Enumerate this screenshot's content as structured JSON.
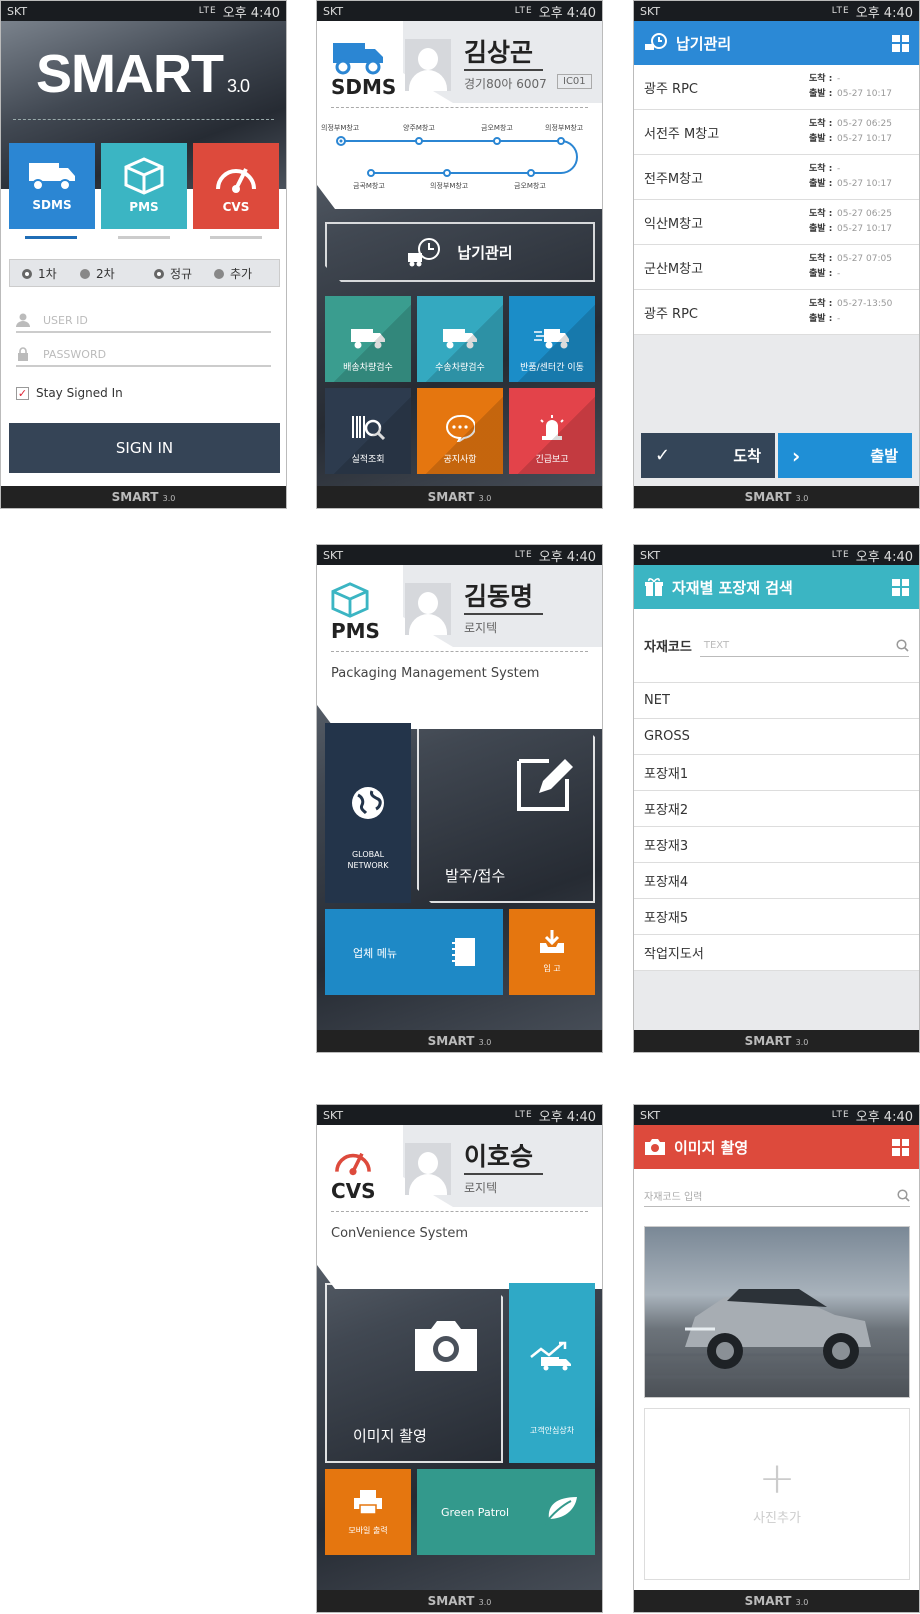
{
  "status": {
    "carrier": "SKT",
    "net": "LTE",
    "time": "오후 4:40"
  },
  "footer": {
    "brand": "SMART",
    "ver": "3.0"
  },
  "login": {
    "logo": "SMART",
    "logo_ver": "3.0",
    "apps": [
      {
        "label": "SDMS",
        "color": "#2b86d3"
      },
      {
        "label": "PMS",
        "color": "#3bb5c3"
      },
      {
        "label": "CVS",
        "color": "#dd4a3c"
      }
    ],
    "radios": [
      "1차",
      "2차",
      "정규",
      "추가"
    ],
    "user_placeholder": "USER ID",
    "pass_placeholder": "PASSWORD",
    "stay": "Stay Signed In",
    "signin": "SIGN IN"
  },
  "sdms": {
    "brand": "SDMS",
    "name": "김상곤",
    "plate": "경기80아 6007",
    "code": "IC01",
    "route_top": [
      "의정부M창고",
      "양주M창고",
      "금오M창고",
      "의정부M창고"
    ],
    "route_bot": [
      "금곡M창고",
      "의정부M창고",
      "금오M창고"
    ],
    "main": "납기관리",
    "tiles": [
      {
        "label": "배송차량검수",
        "color": "#3a9d8f"
      },
      {
        "label": "수송차량검수",
        "color": "#34a9c0"
      },
      {
        "label": "반품/센터간 이동",
        "color": "#1b8dc8"
      },
      {
        "label": "실적조회",
        "color": "#2d3b4e"
      },
      {
        "label": "공지사항",
        "color": "#e5760f"
      },
      {
        "label": "긴급보고",
        "color": "#e3434a"
      }
    ]
  },
  "delivery": {
    "title": "납기관리",
    "arr": "도착 :",
    "dep": "출발 :",
    "rows": [
      {
        "name": "광주 RPC",
        "a": "-",
        "d": "05-27 10:17"
      },
      {
        "name": "서전주 M창고",
        "a": "05-27 06:25",
        "d": "05-27 10:17"
      },
      {
        "name": "전주M창고",
        "a": "-",
        "d": "05-27 10:17"
      },
      {
        "name": "익산M창고",
        "a": "05-27 06:25",
        "d": "05-27 10:17"
      },
      {
        "name": "군산M창고",
        "a": "05-27 07:05",
        "d": "-"
      },
      {
        "name": "광주 RPC",
        "a": "05-27-13:50",
        "d": "-"
      }
    ],
    "btn_arrive": "도착",
    "btn_depart": "출발"
  },
  "pms": {
    "brand": "PMS",
    "name": "김동명",
    "company": "로지텍",
    "full": "Packaging Management System",
    "global": "GLOBAL NETWORK",
    "order": "발주/접수",
    "vendor": "업체 메뉴",
    "inbound": "입 고"
  },
  "search": {
    "title": "자재별 포장재 검색",
    "label": "자재코드",
    "placeholder": "TEXT",
    "items": [
      "NET",
      "GROSS",
      "포장재1",
      "포장재2",
      "포장재3",
      "포장재4",
      "포장재5",
      "작업지도서"
    ]
  },
  "cvs": {
    "brand": "CVS",
    "name": "이호승",
    "company": "로지텍",
    "full": "ConVenience System",
    "capture": "이미지 촬영",
    "safe": "고객안심상차",
    "print": "모바일 출력",
    "green": "Green Patrol"
  },
  "image": {
    "title": "이미지 촬영",
    "placeholder": "자재코드 입력",
    "add": "사진추가"
  }
}
